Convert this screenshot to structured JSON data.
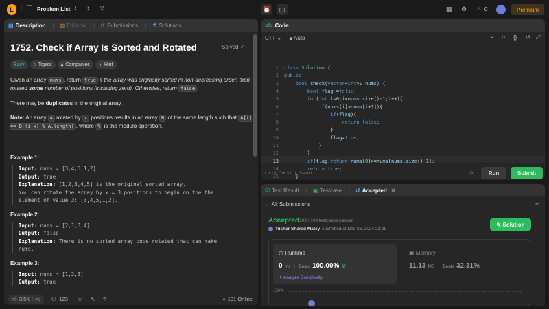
{
  "nav": {
    "problem_list": "Problem List",
    "coins": "0",
    "premium": "Premium"
  },
  "left_tabs": {
    "description": "Description",
    "editorial": "Editorial",
    "submissions": "Submissions",
    "solutions": "Solutions"
  },
  "problem": {
    "title": "1752. Check if Array Is Sorted and Rotated",
    "status": "Solved",
    "tags": [
      "Easy",
      "Topics",
      "Companies",
      "Hint"
    ],
    "p1": {
      "a": "Given an array ",
      "c1": "nums",
      "b": ", return ",
      "c2": "true",
      "c": " if the array was originally sorted in non-decreasing order, then rotated ",
      "d": "some",
      "e": " number of positions (including zero). Otherwise, return ",
      "c3": "false",
      "f": "."
    },
    "p2": {
      "a": "There may be ",
      "b": "duplicates",
      "c": " in the original array."
    },
    "p3": {
      "note": "Note:",
      "a": " An array ",
      "c1": "A",
      "b": " rotated by ",
      "c2": "x",
      "c": " positions results in an array ",
      "c3": "B",
      "d": " of the same length such that ",
      "c4": "A[i] == B[(i+x) % A.length]",
      "e": ", where ",
      "c5": "%",
      "f": " is the modulo operation."
    },
    "examples": [
      {
        "title": "Example 1:",
        "input": "nums = [3,4,5,1,2]",
        "output": "true",
        "explanation": "[1,2,3,4,5] is the original sorted array.",
        "extra": [
          "You can rotate the array by x = 3 positions to begin on the the",
          "element of value 3: [3,4,5,1,2]."
        ]
      },
      {
        "title": "Example 2:",
        "input": "nums = [2,1,3,4]",
        "output": "false",
        "explanation": "There is no sorted array once rotated that can make",
        "extra": [
          "nums."
        ]
      },
      {
        "title": "Example 3:",
        "input": "nums = [1,2,3]",
        "output": "true"
      }
    ],
    "labels": {
      "input": "Input:",
      "output": "Output:",
      "explanation": "Explanation:"
    }
  },
  "bottom_left": {
    "likes": "3.5K",
    "comments": "123",
    "online": "131 Online"
  },
  "code": {
    "tab": "Code",
    "lang": "C++",
    "auto": "Auto",
    "status": "Ln 13, Col 33",
    "saved": "Saved",
    "run": "Run",
    "submit": "Submit",
    "lines": [
      "class Solution {",
      "public:",
      "    bool check(vector<int>& nums) {",
      "        bool flag =false;",
      "        for(int i=0;i<nums.size()-1;i++){",
      "            if(nums[i]>nums[i+1]){",
      "                if(flag){",
      "                    return false;",
      "                }",
      "                flag=true;",
      "            }",
      "        }",
      "        if(flag)return nums[0]>=nums[nums.size()-1];",
      "        return true;",
      "    }",
      "};"
    ]
  },
  "result": {
    "tab_result": "Test Result",
    "tab_testcase": "Testcase",
    "tab_accepted": "Accepted",
    "all_submissions": "All Submissions",
    "verdict": "Accepted",
    "passed": "109 / 109 testcases passed",
    "user": "Tushar Sharad Matey",
    "submitted": "submitted at Dec 26, 2024 22:29",
    "solution_btn": "Solution",
    "runtime_label": "Runtime",
    "runtime_value": "0",
    "runtime_unit": "ms",
    "beats": "Beats",
    "runtime_beats": "100.00%",
    "analyze": "Analyze Complexity",
    "memory_label": "Memory",
    "memory_value": "11.13",
    "memory_unit": "MB",
    "memory_beats": "32.31%",
    "chart_tick": "150%"
  },
  "colors": {
    "accent": "#ffa116",
    "green": "#2cbb5d",
    "blue": "#0a84ff"
  }
}
